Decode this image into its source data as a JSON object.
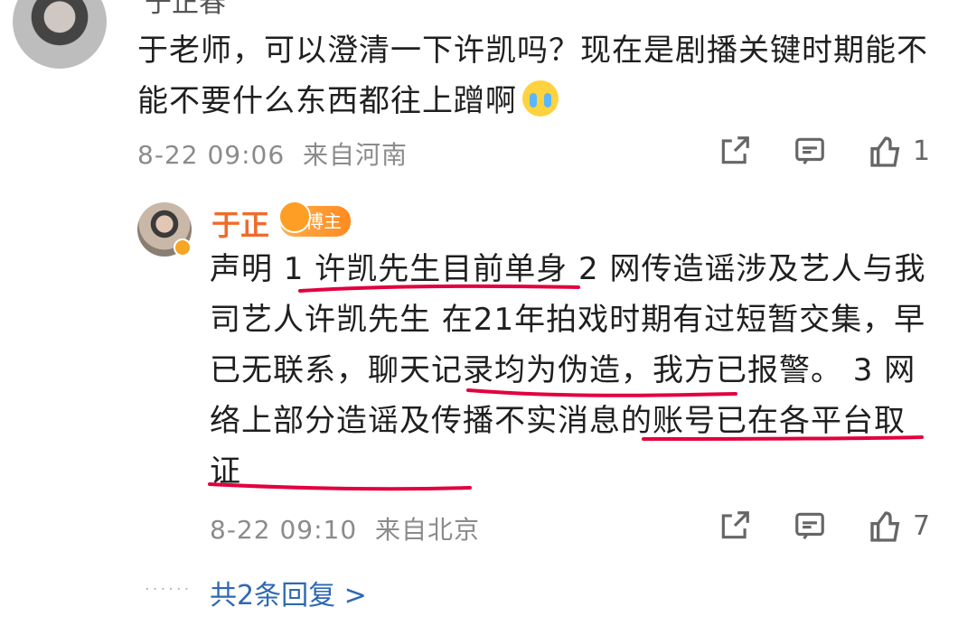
{
  "comment1": {
    "username": "于正春",
    "text": "于老师，可以澄清一下许凯吗？现在是剧播关键时期能不能不要什么东西都往上蹭啊",
    "time": "8-22 09:06",
    "location": "来自河南",
    "likes": "1"
  },
  "comment2": {
    "username": "于正",
    "badge": "博主",
    "text": "声明 1 许凯先生目前单身 2 网传造谣涉及艺人与我司艺人许凯先生 在21年拍戏时期有过短暂交集，早已无联系，聊天记录均为伪造，我方已报警。 3 网络上部分造谣及传播不实消息的账号已在各平台取证",
    "time": "8-22 09:10",
    "location": "来自北京",
    "likes": "7"
  },
  "replies": {
    "dots": "······",
    "label": "共2条回复 >"
  },
  "colors": {
    "accent_name": "#f06b2a",
    "link": "#2e68b3",
    "underline": "#e2003e"
  },
  "icons": [
    "share-icon",
    "comment-icon",
    "like-icon",
    "crying-emoji-icon",
    "crown-icon",
    "verified-icon"
  ]
}
